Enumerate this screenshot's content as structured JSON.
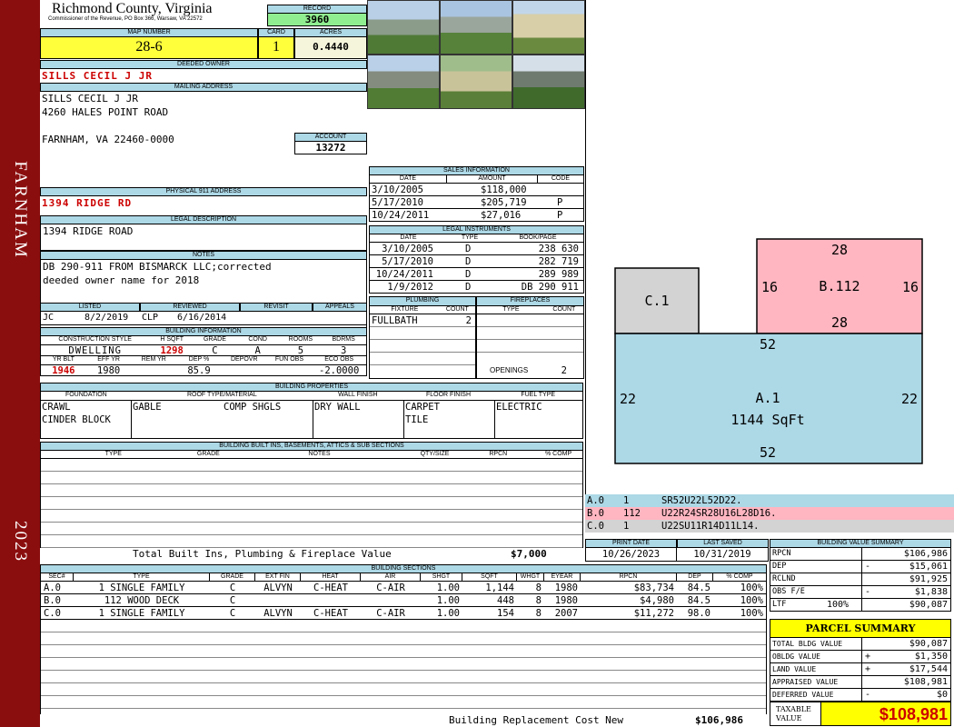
{
  "sidebar": {
    "city": "FARNHAM",
    "year": "2023"
  },
  "header": {
    "county": "Richmond County, Virginia",
    "commissioner": "Commissioner of the Revenue, PO Box 366, Warsaw, VA 22572",
    "record_label": "RECORD",
    "record": "3960",
    "map_label": "MAP NUMBER",
    "map": "28-6",
    "card_label": "CARD",
    "card": "1",
    "acres_label": "ACRES",
    "acres": "0.4440"
  },
  "owner": {
    "deeded_label": "DEEDED OWNER",
    "deeded": "SILLS CECIL J JR",
    "mailing_label": "MAILING ADDRESS",
    "mailing": [
      "SILLS CECIL J JR",
      "4260 HALES POINT ROAD",
      "",
      "FARNHAM, VA 22460-0000"
    ],
    "account_label": "ACCOUNT",
    "account": "13272",
    "physical_label": "PHYSICAL 911 ADDRESS",
    "physical": "1394 RIDGE RD",
    "legal_label": "LEGAL DESCRIPTION",
    "legal": "1394 RIDGE ROAD",
    "notes_label": "NOTES",
    "notes": [
      "DB 290-911 FROM BISMARCK LLC;corrected",
      "deeded owner name for 2018"
    ]
  },
  "review": {
    "headers": [
      "LISTED",
      "REVIEWED",
      "REVISIT",
      "APPEALS"
    ],
    "listed_by": "JC",
    "listed": "8/2/2019",
    "reviewed_by": "CLP",
    "reviewed": "6/16/2014",
    "revisit": "",
    "appeals": ""
  },
  "building_info": {
    "title": "BUILDING INFORMATION",
    "h1": [
      "CONSTRUCTION STYLE",
      "H SQFT",
      "GRADE",
      "COND",
      "ROOMS",
      "BDRMS"
    ],
    "v1": [
      "DWELLING",
      "1298",
      "C",
      "A",
      "5",
      "3"
    ],
    "h2": [
      "YR BLT",
      "EFF YR",
      "REM YR",
      "DEP %",
      "DEPOVR",
      "FUN OBS",
      "ECO OBS"
    ],
    "v2": [
      "1946",
      "1980",
      "",
      "85.9",
      "",
      "",
      "-2.0000"
    ]
  },
  "sales": {
    "title": "SALES INFORMATION",
    "headers": [
      "DATE",
      "AMOUNT",
      "CODE"
    ],
    "rows": [
      [
        "3/10/2005",
        "$118,000",
        ""
      ],
      [
        "5/17/2010",
        "$205,719",
        "P"
      ],
      [
        "10/24/2011",
        "$27,016",
        "P"
      ]
    ]
  },
  "instruments": {
    "title": "LEGAL INSTRUMENTS",
    "headers": [
      "DATE",
      "TYPE",
      "BOOK/PAGE"
    ],
    "rows": [
      [
        "3/10/2005",
        "D",
        "238 630"
      ],
      [
        "5/17/2010",
        "D",
        "282 719"
      ],
      [
        "10/24/2011",
        "D",
        "289 989"
      ],
      [
        "1/9/2012",
        "D",
        "DB 290 911"
      ]
    ]
  },
  "plumbing": {
    "title": "PLUMBING",
    "headers": [
      "FIXTURE",
      "COUNT"
    ],
    "rows": [
      [
        "FULLBATH",
        "2"
      ]
    ]
  },
  "fireplaces": {
    "title": "FIREPLACES",
    "headers": [
      "TYPE",
      "COUNT"
    ],
    "openings_label": "OPENINGS",
    "openings": "2"
  },
  "properties": {
    "title": "BUILDING PROPERTIES",
    "headers": [
      "FOUNDATION",
      "ROOF TYPE/MATERIAL",
      "WALL FINISH",
      "FLOOR FINISH",
      "FUEL TYPE"
    ],
    "foundation": [
      "CRAWL",
      "CINDER BLOCK"
    ],
    "roof_type": "GABLE",
    "roof_material": "COMP SHGLS",
    "wall": "DRY WALL",
    "floor": [
      "CARPET",
      "TILE"
    ],
    "fuel": "ELECTRIC"
  },
  "builtins": {
    "title": "BUILDING BUILT INS, BASEMENTS, ATTICS & SUB SECTIONS",
    "headers": [
      "TYPE",
      "GRADE",
      "NOTES",
      "QTY/SIZE",
      "RPCN",
      "% COMP"
    ],
    "total_label": "Total Built Ins, Plumbing & Fireplace Value",
    "total": "$7,000"
  },
  "sections": {
    "title": "BUILDING SECTIONS",
    "headers": [
      "SEC#",
      "TYPE",
      "GRADE",
      "EXT FIN",
      "HEAT",
      "AIR",
      "SHGT",
      "SQFT",
      "WHGT",
      "EYEAR",
      "RPCN",
      "DEP",
      "% COMP"
    ],
    "rows": [
      [
        "A.0",
        "1 SINGLE FAMILY",
        "C",
        "ALVYN",
        "C-HEAT",
        "C-AIR",
        "1.00",
        "1,144",
        "8",
        "1980",
        "$83,734",
        "84.5",
        "100%"
      ],
      [
        "B.0",
        "112 WOOD DECK",
        "C",
        "",
        "",
        "",
        "1.00",
        "448",
        "8",
        "1980",
        "$4,980",
        "84.5",
        "100%"
      ],
      [
        "C.0",
        "1 SINGLE FAMILY",
        "C",
        "ALVYN",
        "C-HEAT",
        "C-AIR",
        "1.00",
        "154",
        "8",
        "2007",
        "$11,272",
        "98.0",
        "100%"
      ]
    ],
    "replacement_label": "Building Replacement Cost New",
    "replacement": "$106,986"
  },
  "sketch": {
    "a_label": "A.1",
    "a_area": "1144 SqFt",
    "a_top": "52",
    "a_bottom": "52",
    "a_left": "22",
    "a_right": "22",
    "b_label": "B.112",
    "b_top": "28",
    "b_bottom": "28",
    "b_left": "16",
    "b_right": "16",
    "c_label": "C.1",
    "codes": [
      [
        "A.0",
        "1",
        "SR52U22L52D22."
      ],
      [
        "B.0",
        "112",
        "U22R24SR28U16L28D16."
      ],
      [
        "C.0",
        "1",
        "U22SU11R14D11L14."
      ]
    ],
    "colors": {
      "a": "#add8e6",
      "b": "#ffb6c1",
      "c": "#d3d3d3"
    }
  },
  "dates": {
    "print_label": "PRINT DATE",
    "print": "10/26/2023",
    "saved_label": "LAST SAVED",
    "saved": "10/31/2019"
  },
  "value_summary": {
    "title": "BUILDING VALUE SUMMARY",
    "rows": [
      [
        "RPCN",
        "",
        "$106,986"
      ],
      [
        "DEP",
        "-",
        "$15,061"
      ],
      [
        "RCLND",
        "",
        "$91,925"
      ],
      [
        "OBS F/E",
        "-",
        "$1,838"
      ],
      [
        "LTF",
        "100%",
        "$90,087"
      ]
    ]
  },
  "parcel": {
    "title": "PARCEL SUMMARY",
    "rows": [
      [
        "TOTAL BLDG VALUE",
        "",
        "$90,087"
      ],
      [
        "OBLDG VALUE",
        "+",
        "$1,350"
      ],
      [
        "LAND VALUE",
        "+",
        "$17,544"
      ],
      [
        "APPRAISED VALUE",
        "",
        "$108,981"
      ],
      [
        "DEFERRED VALUE",
        "-",
        "$0"
      ]
    ],
    "taxable_label": "TAXABLE VALUE",
    "taxable": "$108,981"
  }
}
